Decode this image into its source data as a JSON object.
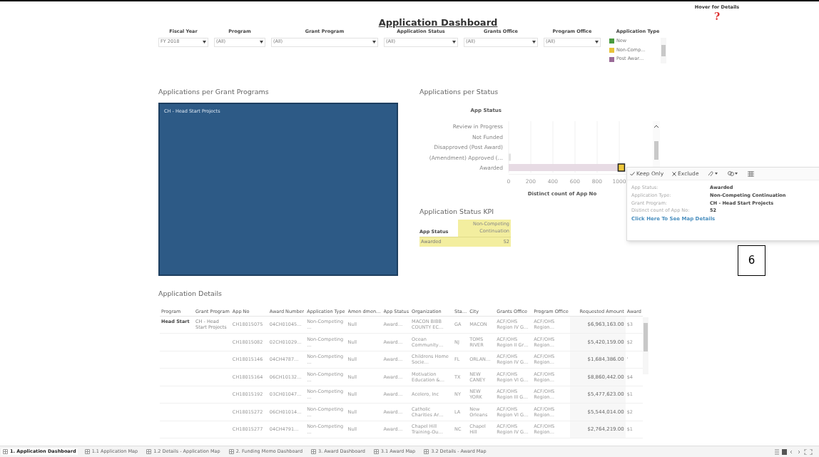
{
  "title": "Application Dashboard",
  "hover": {
    "label": "Hover for Details",
    "icon_text": "?"
  },
  "filters": [
    {
      "label": "Fiscal Year",
      "value": "FY 2018"
    },
    {
      "label": "Program",
      "value": "(All)"
    },
    {
      "label": "Grant Program",
      "value": "(All)"
    },
    {
      "label": "Application Status",
      "value": "(All)"
    },
    {
      "label": "Grants Office",
      "value": "(All)"
    },
    {
      "label": "Program Office",
      "value": "(All)"
    }
  ],
  "legend": {
    "title": "Application Type",
    "items": [
      {
        "label": "New",
        "color": "#4a9a3f"
      },
      {
        "label": "Non-Comp…",
        "color": "#e8c23a"
      },
      {
        "label": "Post Awar…",
        "color": "#9a6b98"
      }
    ]
  },
  "grant_programs": {
    "title": "Applications per Grant Programs",
    "tiles": [
      {
        "label": "CH - Head Start Projects"
      }
    ]
  },
  "status_chart": {
    "title": "Applications per Status",
    "chart_data": {
      "type": "bar",
      "orientation": "horizontal",
      "stacked": true,
      "ylabel": "App Status",
      "xlabel": "Distinct count of App No",
      "categories": [
        "Review in Progress",
        "Not Funded",
        "Disapproved (Post Award)",
        "(Amendment) Approved (…",
        "Awarded"
      ],
      "grid": true,
      "xlim": [
        0,
        1100
      ],
      "xticks": [
        0,
        200,
        400,
        600,
        800,
        1000
      ],
      "series": [
        {
          "color": "#e7dbe4",
          "values": [
            null,
            null,
            null,
            null,
            990
          ]
        },
        {
          "color": "#f0c93c",
          "values": [
            null,
            null,
            null,
            null,
            52
          ]
        },
        {
          "color": "#e2e2e2",
          "values": [
            null,
            null,
            null,
            20,
            null
          ]
        }
      ]
    }
  },
  "tooltip": {
    "actions": [
      {
        "kind": "keep",
        "label": "Keep Only"
      },
      {
        "kind": "exclude",
        "label": "Exclude"
      },
      {
        "kind": "group"
      },
      {
        "kind": "set"
      },
      {
        "kind": "view"
      }
    ],
    "fields": [
      {
        "label": "App Status:",
        "value": "Awarded"
      },
      {
        "label": "Application Type:",
        "value": "Non-Competing Continuation"
      },
      {
        "label": "Grant Program:",
        "value": "CH - Head Start Projects"
      },
      {
        "label": "Distinct count of App No:",
        "value": "52"
      }
    ],
    "link": "Click Here To See Map Details"
  },
  "kpi": {
    "title": "Application Status KPI",
    "row_header": "App Status",
    "column_header": "Non-Competing Continuation",
    "rows": [
      {
        "status": "Awarded",
        "value": "52"
      }
    ]
  },
  "annotation": "6",
  "details": {
    "title": "Application Details",
    "columns": [
      "Program",
      "Grant Program",
      "App No",
      "Award Number",
      "Application Type",
      "Amen dmen…",
      "App Status",
      "Organization",
      "Sta…",
      "City",
      "Grants Office",
      "Program Office",
      "Requested Amount",
      "Award"
    ],
    "rows": [
      [
        "Head Start",
        "CH - Head Start Projects",
        "CH18015075",
        "04CH01045…",
        "Non-Competing …",
        "Null",
        "Award…",
        "MACON BIBB COUNTY EC…",
        "GA",
        "MACON",
        "ACF/OHS Region IV G…",
        "ACF/OHS Region…",
        "$6,963,163.00",
        "$3"
      ],
      [
        "",
        "",
        "CH18015082",
        "02CH01029…",
        "Non-Competing …",
        "Null",
        "Award…",
        "Ocean Community…",
        "NJ",
        "TOMS RIVER",
        "ACF/OHS Region II Gr…",
        "ACF/OHS Region…",
        "$5,420,159.00",
        "$2"
      ],
      [
        "",
        "",
        "CH18015146",
        "04CH4787…",
        "Non-Competing …",
        "Null",
        "Award…",
        "Childrens Home Socie…",
        "FL",
        "ORLAN…",
        "ACF/OHS Region IV G…",
        "ACF/OHS Region…",
        "$1,684,386.00",
        "'"
      ],
      [
        "",
        "",
        "CH18015164",
        "06CH10132…",
        "Non-Competing …",
        "Null",
        "Award…",
        "Motivation Education &…",
        "TX",
        "NEW CANEY",
        "ACF/OHS Region VI G…",
        "ACF/OHS Region…",
        "$8,860,442.00",
        "$4"
      ],
      [
        "",
        "",
        "CH18015192",
        "03CH01047…",
        "Non-Competing …",
        "Null",
        "Award…",
        "Acelero, Inc",
        "NY",
        "NEW YORK",
        "ACF/OHS Region III G…",
        "ACF/OHS Region…",
        "$5,477,623.00",
        "$1"
      ],
      [
        "",
        "",
        "CH18015272",
        "06CH01014…",
        "Non-Competing …",
        "Null",
        "Award…",
        "Catholic Charities Ar…",
        "LA",
        "New Orleans",
        "ACF/OHS Region VI G…",
        "ACF/OHS Region…",
        "$5,544,014.00",
        "$2"
      ],
      [
        "",
        "",
        "CH18015277",
        "04CH4791…",
        "Non-Competing …",
        "Null",
        "Award…",
        "Chapel Hill Training-Ou…",
        "NC",
        "Chapel Hill",
        "ACF/OHS Region IV G…",
        "ACF/OHS Region…",
        "$2,764,219.00",
        "$1"
      ]
    ]
  },
  "sheet_tabs": [
    {
      "label": "1. Application Dashboard",
      "selected": true
    },
    {
      "label": "1.1 Application Map",
      "selected": false
    },
    {
      "label": "1.2 Details - Application Map",
      "selected": false
    },
    {
      "label": "2. Funding Memo Dashboard",
      "selected": false
    },
    {
      "label": "3. Award Dashboard",
      "selected": false
    },
    {
      "label": "3.1 Award Map",
      "selected": false
    },
    {
      "label": "3.2 Details - Award Map",
      "selected": false
    }
  ]
}
